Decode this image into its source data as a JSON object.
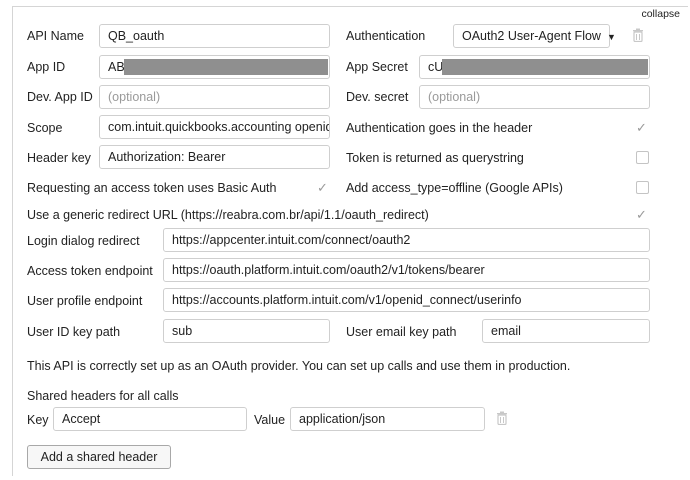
{
  "collapse_label": "collapse",
  "fields": {
    "api_name": {
      "label": "API Name",
      "value": "QB_oauth"
    },
    "authentication": {
      "label": "Authentication",
      "value": "OAuth2 User-Agent Flow"
    },
    "app_id": {
      "label": "App ID",
      "value": "AB"
    },
    "app_secret": {
      "label": "App Secret",
      "value": "cU"
    },
    "dev_app_id": {
      "label": "Dev. App ID",
      "placeholder": "(optional)"
    },
    "dev_secret": {
      "label": "Dev. secret",
      "placeholder": "(optional)"
    },
    "scope": {
      "label": "Scope",
      "value": "com.intuit.quickbooks.accounting openid profile"
    },
    "header_key": {
      "label": "Header key",
      "value": "Authorization: Bearer"
    },
    "login_dialog_redirect": {
      "label": "Login dialog redirect",
      "value": "https://appcenter.intuit.com/connect/oauth2"
    },
    "access_token_endpoint": {
      "label": "Access token endpoint",
      "value": "https://oauth.platform.intuit.com/oauth2/v1/tokens/bearer"
    },
    "user_profile_endpoint": {
      "label": "User profile endpoint",
      "value": "https://accounts.platform.intuit.com/v1/openid_connect/userinfo"
    },
    "user_id_key_path": {
      "label": "User ID key path",
      "value": "sub"
    },
    "user_email_key_path": {
      "label": "User email key path",
      "value": "email"
    }
  },
  "options": {
    "auth_in_header": {
      "label": "Authentication goes in the header",
      "checked": true
    },
    "token_querystring": {
      "label": "Token is returned as querystring",
      "checked": false
    },
    "basic_auth": {
      "label": "Requesting an access token uses Basic Auth",
      "checked": true
    },
    "access_type_offline": {
      "label": "Add access_type=offline (Google APIs)",
      "checked": false
    },
    "generic_redirect": {
      "label": "Use a generic redirect URL (https://reabra.com.br/api/1.1/oauth_redirect)",
      "checked": true
    }
  },
  "status_message": "This API is correctly set up as an OAuth provider. You can set up calls and use them in production.",
  "shared_headers": {
    "title": "Shared headers for all calls",
    "key_label": "Key",
    "value_label": "Value",
    "rows": [
      {
        "key": "Accept",
        "value": "application/json"
      }
    ],
    "add_button_label": "Add a shared header"
  },
  "colors": {
    "redaction": "#8f8f8f",
    "border": "#cfcfcf",
    "check": "#9a9a9a"
  },
  "icons": [
    "trash-icon",
    "checkmark-icon",
    "caret-down-icon"
  ]
}
